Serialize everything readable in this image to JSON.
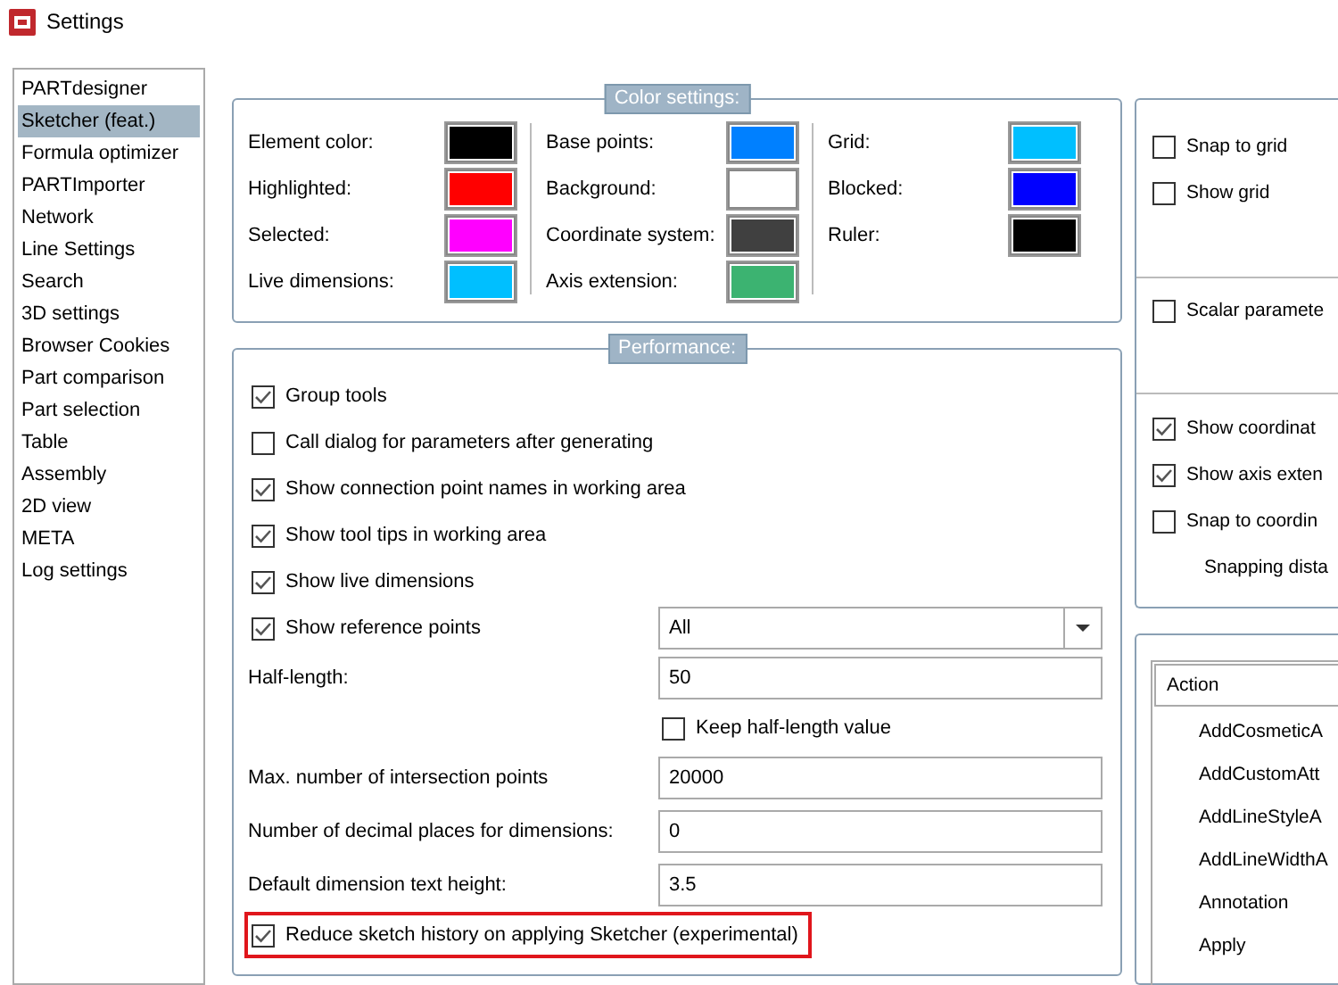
{
  "window": {
    "title": "Settings"
  },
  "sidebar": {
    "items": [
      {
        "label": "PARTdesigner",
        "selected": false
      },
      {
        "label": "Sketcher (feat.)",
        "selected": true
      },
      {
        "label": "Formula optimizer",
        "selected": false
      },
      {
        "label": "PARTImporter",
        "selected": false
      },
      {
        "label": "Network",
        "selected": false
      },
      {
        "label": "Line Settings",
        "selected": false
      },
      {
        "label": "Search",
        "selected": false
      },
      {
        "label": "3D settings",
        "selected": false
      },
      {
        "label": "Browser Cookies",
        "selected": false
      },
      {
        "label": "Part comparison",
        "selected": false
      },
      {
        "label": "Part selection",
        "selected": false
      },
      {
        "label": "Table",
        "selected": false
      },
      {
        "label": "Assembly",
        "selected": false
      },
      {
        "label": "2D view",
        "selected": false
      },
      {
        "label": "META",
        "selected": false
      },
      {
        "label": "Log settings",
        "selected": false
      }
    ]
  },
  "color_settings": {
    "title": "Color settings:",
    "columns": [
      [
        {
          "label": "Element color:",
          "color": "#000000"
        },
        {
          "label": "Highlighted:",
          "color": "#ff0000"
        },
        {
          "label": "Selected:",
          "color": "#ff00ff"
        },
        {
          "label": "Live dimensions:",
          "color": "#00bfff"
        }
      ],
      [
        {
          "label": "Base points:",
          "color": "#0080ff"
        },
        {
          "label": "Background:",
          "color": "#ffffff"
        },
        {
          "label": "Coordinate system:",
          "color": "#404040"
        },
        {
          "label": "Axis extension:",
          "color": "#3cb371"
        }
      ],
      [
        {
          "label": "Grid:",
          "color": "#00bfff"
        },
        {
          "label": "Blocked:",
          "color": "#0000ff"
        },
        {
          "label": "Ruler:",
          "color": "#000000"
        }
      ]
    ]
  },
  "performance": {
    "title": "Performance:",
    "items": [
      {
        "kind": "checkbox",
        "label": "Group tools",
        "checked": true,
        "highlighted": false
      },
      {
        "kind": "checkbox",
        "label": "Call dialog for parameters after generating",
        "checked": false,
        "highlighted": false
      },
      {
        "kind": "checkbox",
        "label": "Show connection point names in working area",
        "checked": true,
        "highlighted": false
      },
      {
        "kind": "checkbox",
        "label": "Show tool tips in working area",
        "checked": true,
        "highlighted": false
      },
      {
        "kind": "checkbox",
        "label": "Show live dimensions",
        "checked": true,
        "highlighted": false
      },
      {
        "kind": "dropdown",
        "label": "Show reference points",
        "checked": true,
        "value": "All",
        "highlighted": false
      },
      {
        "kind": "field",
        "label": "Half-length:",
        "value": "50",
        "highlighted": false
      },
      {
        "kind": "subcheckbox",
        "label": "Keep half-length value",
        "checked": false,
        "highlighted": false
      },
      {
        "kind": "field",
        "label": "Max. number of intersection points",
        "value": "20000",
        "highlighted": false
      },
      {
        "kind": "field",
        "label": "Number of decimal places for dimensions:",
        "value": "0",
        "highlighted": false
      },
      {
        "kind": "field",
        "label": "Default dimension text height:",
        "value": "3.5",
        "highlighted": false
      },
      {
        "kind": "checkbox",
        "label": "Reduce sketch history on applying Sketcher (experimental)",
        "checked": true,
        "highlighted": true
      }
    ]
  },
  "right_panel": {
    "sections": [
      [
        {
          "kind": "checkbox",
          "label": "Snap to grid",
          "checked": false
        },
        {
          "kind": "checkbox",
          "label": "Show grid",
          "checked": false
        }
      ],
      [
        {
          "kind": "checkbox",
          "label": "Scalar paramete",
          "checked": false
        }
      ],
      [
        {
          "kind": "checkbox",
          "label": "Show coordinat",
          "checked": true
        },
        {
          "kind": "checkbox",
          "label": "Show axis exten",
          "checked": true
        },
        {
          "kind": "checkbox",
          "label": "Snap to coordin",
          "checked": false
        },
        {
          "kind": "label",
          "label": "Snapping dista"
        }
      ]
    ]
  },
  "action_list": {
    "header": "Action",
    "items": [
      "AddCosmeticA",
      "AddCustomAtt",
      "AddLineStyleA",
      "AddLineWidthA",
      "Annotation",
      "Apply"
    ]
  }
}
